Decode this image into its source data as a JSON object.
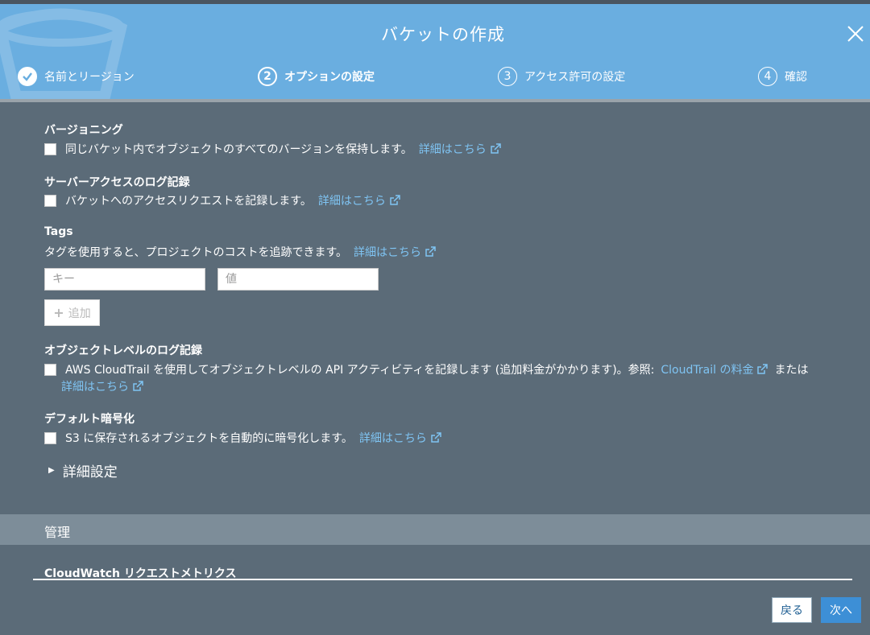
{
  "dialog": {
    "title": "バケットの作成",
    "steps": [
      {
        "number": "",
        "label": "名前とリージョン",
        "state": "done"
      },
      {
        "number": "2",
        "label": "オプションの設定",
        "state": "active"
      },
      {
        "number": "3",
        "label": "アクセス許可の設定",
        "state": "pending"
      },
      {
        "number": "4",
        "label": "確認",
        "state": "pending"
      }
    ]
  },
  "versioning": {
    "title": "バージョニング",
    "text": "同じバケット内でオブジェクトのすべてのバージョンを保持します。",
    "link": "詳細はこちら"
  },
  "access_log": {
    "title": "サーバーアクセスのログ記録",
    "text": "バケットへのアクセスリクエストを記録します。",
    "link": "詳細はこちら"
  },
  "tags": {
    "title": "Tags",
    "text": "タグを使用すると、プロジェクトのコストを追跡できます。",
    "link": "詳細はこちら",
    "key_placeholder": "キー",
    "value_placeholder": "値",
    "add_label": "追加"
  },
  "object_log": {
    "title": "オブジェクトレベルのログ記録",
    "text": "AWS CloudTrail を使用してオブジェクトレベルの API アクティビティを記録します (追加料金がかかります)。参照:",
    "pricing_link": "CloudTrail の料金",
    "or": "または",
    "link": "詳細はこちら"
  },
  "encryption": {
    "title": "デフォルト暗号化",
    "text": "S3 に保存されるオブジェクトを自動的に暗号化します。",
    "link": "詳細はこちら"
  },
  "advanced_label": "詳細設定",
  "management": {
    "title": "管理",
    "cloudwatch_title": "CloudWatch リクエストメトリクス"
  },
  "footer": {
    "back_label": "戻る",
    "next_label": "次へ"
  },
  "colors": {
    "header": "#6aaee0",
    "body": "#5b6b78",
    "link": "#7fc4f3",
    "primary_button": "#3d8fd6"
  }
}
